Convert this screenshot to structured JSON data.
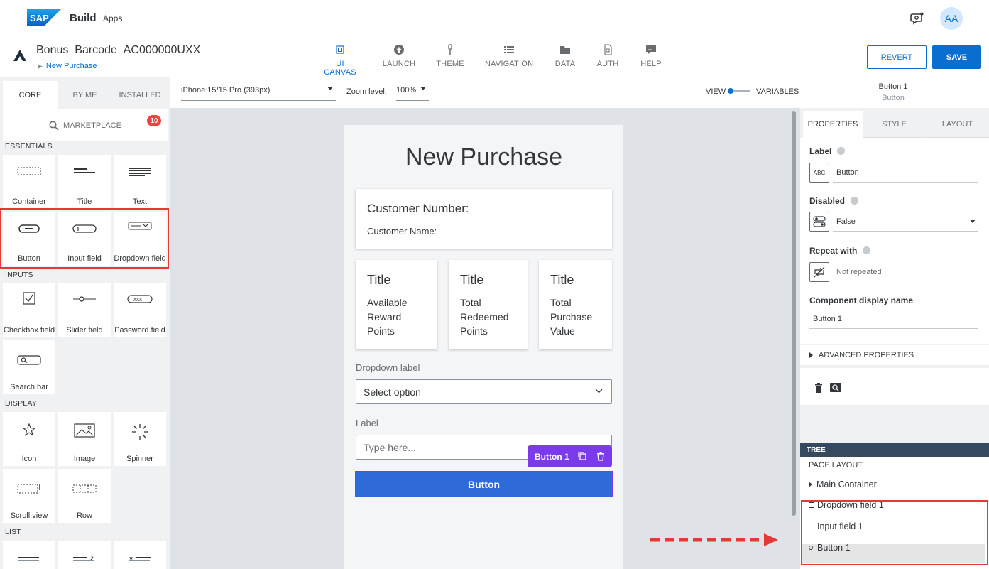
{
  "app": {
    "brand": "SAP",
    "title": "Build",
    "subtitle": "Apps",
    "avatar_initials": "AA"
  },
  "project": {
    "name": "Bonus_Barcode_AC000000UXX",
    "breadcrumb": "New Purchase"
  },
  "nav_tabs": [
    {
      "label": "UI CANVAS",
      "icon": "canvas-icon",
      "active": true
    },
    {
      "label": "LAUNCH",
      "icon": "upload-icon"
    },
    {
      "label": "THEME",
      "icon": "brush-icon"
    },
    {
      "label": "NAVIGATION",
      "icon": "list-icon"
    },
    {
      "label": "DATA",
      "icon": "folder-icon"
    },
    {
      "label": "AUTH",
      "icon": "document-icon"
    },
    {
      "label": "HELP",
      "icon": "chat-icon"
    }
  ],
  "actions": {
    "revert": "REVERT",
    "save": "SAVE"
  },
  "left_panel": {
    "tabs": [
      "CORE",
      "BY ME",
      "INSTALLED"
    ],
    "marketplace": "MARKETPLACE",
    "marketplace_badge": "10",
    "sections": {
      "essentials": "ESSENTIALS",
      "inputs": "INPUTS",
      "display": "DISPLAY",
      "list": "LIST"
    },
    "essentials": [
      "Container",
      "Title",
      "Text",
      "Button",
      "Input field",
      "Dropdown field"
    ],
    "inputs": [
      "Checkbox field",
      "Slider field",
      "Password field",
      "Search bar"
    ],
    "display": [
      "Icon",
      "Image",
      "Spinner",
      "Scroll view",
      "Row"
    ]
  },
  "canvas_toolbar": {
    "device": "iPhone 15/15 Pro (393px)",
    "zoom_label": "Zoom level:",
    "zoom_value": "100%",
    "view_label": "VIEW",
    "variables_label": "VARIABLES"
  },
  "selected_component": {
    "name": "Button 1",
    "type": "Button"
  },
  "phone": {
    "title": "New Purchase",
    "customer_number": "Customer Number:",
    "customer_name": "Customer Name:",
    "stat_cards": [
      {
        "title": "Title",
        "text": "Available Reward Points"
      },
      {
        "title": "Title",
        "text": "Total Redeemed Points"
      },
      {
        "title": "Title",
        "text": "Total Purchase Value"
      }
    ],
    "dropdown_label": "Dropdown label",
    "dropdown_value": "Select option",
    "input_label": "Label",
    "input_placeholder": "Type here...",
    "selection_chip": "Button 1",
    "button_label": "Button"
  },
  "properties": {
    "tabs": [
      "PROPERTIES",
      "STYLE",
      "LAYOUT"
    ],
    "label_title": "Label",
    "label_icon_text": "ABC",
    "label_value": "Button",
    "disabled_title": "Disabled",
    "disabled_value": "False",
    "repeat_title": "Repeat with",
    "repeat_value": "Not repeated",
    "display_name_title": "Component display name",
    "display_name_value": "Button 1",
    "advanced": "ADVANCED PROPERTIES"
  },
  "tree": {
    "header": "TREE",
    "page_layout": "PAGE LAYOUT",
    "main_container": "Main Container",
    "items": [
      "Dropdown field 1",
      "Input field 1",
      "Button 1"
    ]
  },
  "colors": {
    "accent": "#0a6ed1",
    "selection": "#7c3aed",
    "highlight": "#e53935",
    "phone_button": "#2f6bd8"
  }
}
